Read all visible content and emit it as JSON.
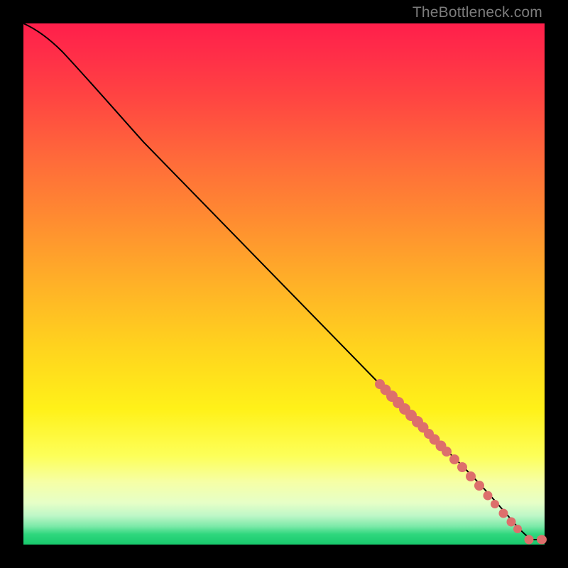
{
  "watermark": "TheBottleneck.com",
  "colors": {
    "bead": "#dd6f6c",
    "curve": "#000000"
  },
  "chart_data": {
    "type": "line",
    "title": "",
    "xlabel": "",
    "ylabel": "",
    "xlim": [
      0,
      100
    ],
    "ylim": [
      0,
      100
    ],
    "grid": false,
    "legend": false,
    "curve": {
      "description": "Monotone decreasing curve from top-left to bottom-right; slight convex bow near top, near-linear middle, flattens to floor at far right.",
      "points_xy": [
        [
          0,
          100
        ],
        [
          3,
          98.5
        ],
        [
          6,
          96.5
        ],
        [
          10,
          93.5
        ],
        [
          15,
          89
        ],
        [
          20,
          84
        ],
        [
          30,
          73
        ],
        [
          40,
          62
        ],
        [
          50,
          51
        ],
        [
          60,
          40
        ],
        [
          68,
          31
        ],
        [
          74,
          24
        ],
        [
          80,
          17
        ],
        [
          85,
          11
        ],
        [
          90,
          5.5
        ],
        [
          93,
          2.5
        ],
        [
          95,
          1.2
        ],
        [
          96.5,
          0.8
        ],
        [
          100,
          0.8
        ]
      ]
    },
    "markers": {
      "description": "Salmon rounded markers clustered along the lower-right quarter of the curve, plus two detached markers at far bottom-right on the floor.",
      "on_curve_segments": [
        {
          "x_start": 68,
          "x_end": 74,
          "style": "dense"
        },
        {
          "x_start": 74,
          "x_end": 80,
          "style": "dense"
        },
        {
          "x_start": 80,
          "x_end": 85,
          "style": "medium"
        },
        {
          "x_start": 85,
          "x_end": 90,
          "style": "medium"
        },
        {
          "x_start": 90,
          "x_end": 93,
          "style": "sparse"
        }
      ],
      "floor_points_x": [
        96.5,
        99.3
      ]
    }
  }
}
